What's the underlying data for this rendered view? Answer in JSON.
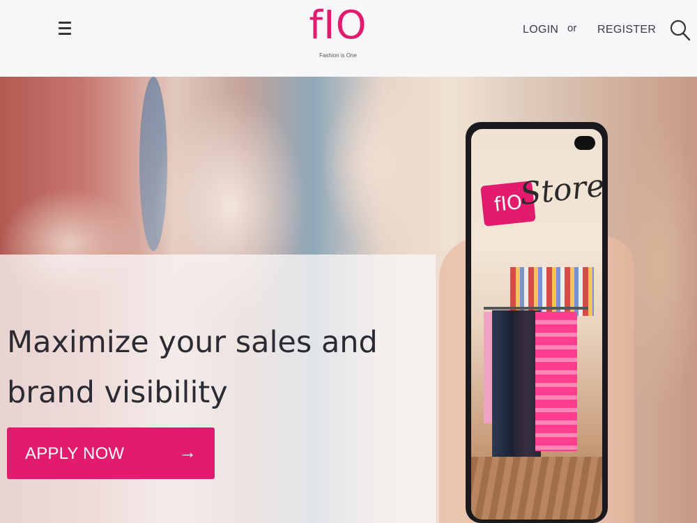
{
  "header": {
    "logo_text": "fIO",
    "tagline": "Fashion is One",
    "login_label": "LOGIN",
    "or_label": "or",
    "register_label": "REGISTER"
  },
  "hero": {
    "headline_line1": "Maximize your sales and",
    "headline_line2": "brand visibility",
    "cta_label": "APPLY NOW",
    "cta_arrow": "→"
  },
  "phone_screen": {
    "tag_text": "fIO",
    "script_text": "Store"
  },
  "icons": [
    "menu-icon",
    "search-icon",
    "arrow-right-icon"
  ],
  "colors": {
    "brand": "#e21b6f",
    "header_bg": "#f7f6f8",
    "text_dark": "#2b2b33"
  }
}
